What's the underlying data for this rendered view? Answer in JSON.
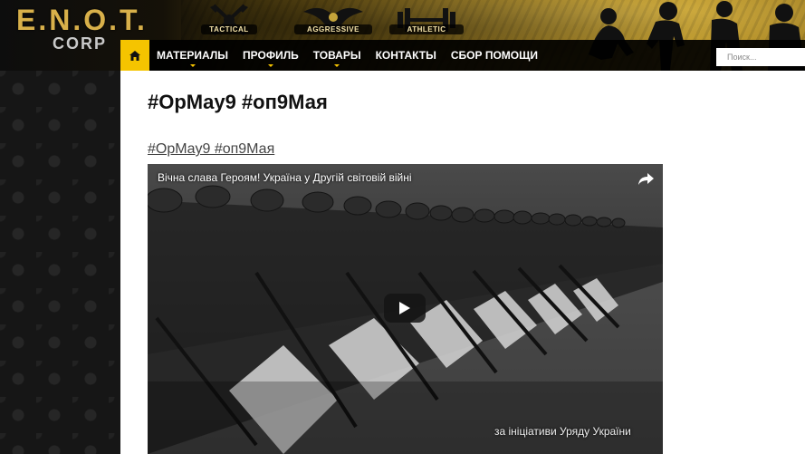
{
  "header": {
    "logo_main": "E.N.O.T.",
    "logo_sub": "CORP",
    "emblems": [
      {
        "label": "TACTICAL",
        "icon": "axes-emblem-icon"
      },
      {
        "label": "AGGRESSIVE",
        "icon": "bird-emblem-icon"
      },
      {
        "label": "ATHLETIC",
        "icon": "barbell-emblem-icon"
      }
    ]
  },
  "nav": {
    "home_icon": "home-icon",
    "items": [
      {
        "label": "МАТЕРИАЛЫ",
        "has_dropdown": true
      },
      {
        "label": "ПРОФИЛЬ",
        "has_dropdown": true
      },
      {
        "label": "ТОВАРЫ",
        "has_dropdown": true
      },
      {
        "label": "КОНТАКТЫ",
        "has_dropdown": false
      },
      {
        "label": "СБОР ПОМОЩИ",
        "has_dropdown": false
      }
    ],
    "search_placeholder": "Поиск..."
  },
  "post": {
    "title": "#OpMay9 #оп9Мая",
    "link_text": "#OpMay9 #оп9Мая"
  },
  "video": {
    "title": "Вічна слава Героям! Україна у Другій світовій війні",
    "caption": "за ініціативи Уряду України",
    "share_icon": "share-icon",
    "play_icon": "play-icon"
  },
  "colors": {
    "accent": "#f5c400",
    "nav_bg": "#000000",
    "content_bg": "#ffffff"
  }
}
